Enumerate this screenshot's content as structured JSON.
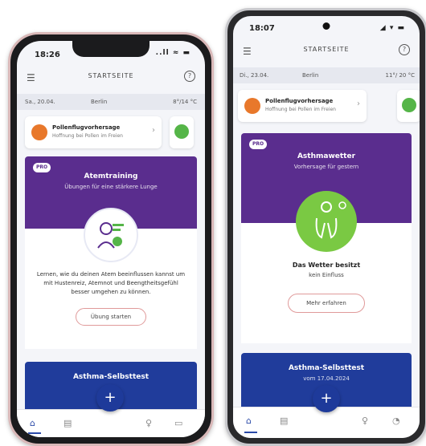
{
  "left_phone": {
    "status": {
      "time": "18:26",
      "sys": "..ll ≈ ▬"
    },
    "header": {
      "title": "STARTSEITE",
      "help": "?"
    },
    "weather": {
      "date": "Sa., 20.04.",
      "city": "Berlin",
      "temp": "8°/14 °C"
    },
    "pollen_card": {
      "title": "Pollenflugvorhersage",
      "subtitle": "Hoffnung bei Pollen im Freien"
    },
    "feature": {
      "badge": "PRO",
      "title": "Atemtraining",
      "subtitle": "Übungen für eine stärkere Lunge"
    },
    "feature_body": "Lernen, wie du deinen Atem beeinflussen kannst um mit Hustenreiz, Atemnot und Beengtheitsgefühl besser umgehen zu können.",
    "feature_button": "Übung starten",
    "bottom_card": {
      "title": "Asthma-Selbsttest"
    },
    "nav": {
      "home": "⌂",
      "diary": "▤",
      "add": "+",
      "tips": "♀",
      "stats": "▭"
    }
  },
  "right_phone": {
    "status": {
      "time": "18:07",
      "sys": "◢ ▾ ▬"
    },
    "header": {
      "title": "STARTSEITE",
      "help": "?"
    },
    "weather": {
      "date": "Di., 23.04.",
      "city": "Berlin",
      "temp": "11°/ 20 °C"
    },
    "pollen_card": {
      "title": "Pollenflugvorhersage",
      "subtitle": "Hoffnung bei Pollen im Freien"
    },
    "feature": {
      "badge": "PRO",
      "title": "Asthmawetter",
      "subtitle": "Vorhersage für gestern"
    },
    "status_title": "Das Wetter besitzt",
    "status_sub": "kein Einfluss",
    "feature_button": "Mehr erfahren",
    "bottom_card": {
      "title": "Asthma-Selbsttest",
      "subtitle": "vom 17.04.2024"
    },
    "nav": {
      "home": "⌂",
      "diary": "▤",
      "add": "+",
      "tips": "♀",
      "stats": "◔"
    }
  },
  "colors": {
    "purple": "#5a2d8e",
    "blue": "#203c9b",
    "green": "#7ac943",
    "orange": "#e8782b"
  }
}
